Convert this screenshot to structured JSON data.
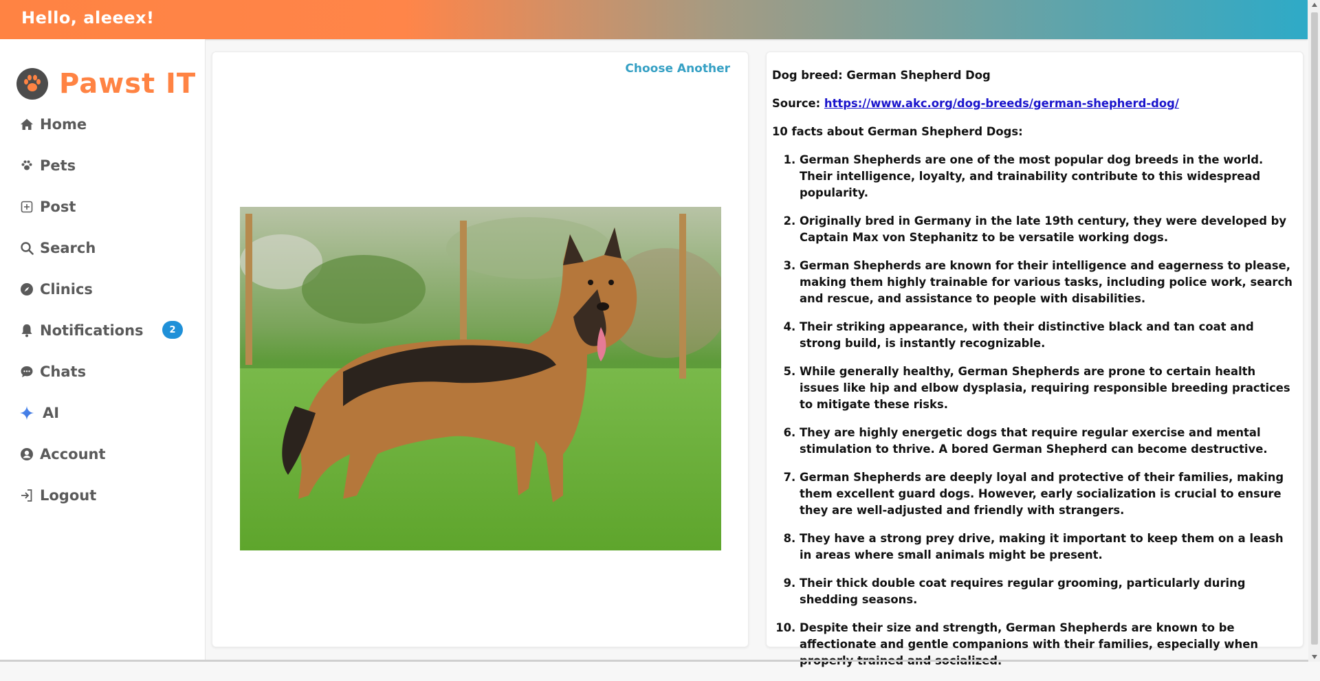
{
  "header": {
    "greeting": "Hello, aleeex!"
  },
  "brand": {
    "name": "Pawst IT",
    "logo_icon": "paw-icon",
    "accent": "#ff8343"
  },
  "sidebar": {
    "items": [
      {
        "label": "Home",
        "icon": "home-icon"
      },
      {
        "label": "Pets",
        "icon": "paw-icon"
      },
      {
        "label": "Post",
        "icon": "plus-square-icon"
      },
      {
        "label": "Search",
        "icon": "search-icon"
      },
      {
        "label": "Clinics",
        "icon": "compass-icon"
      },
      {
        "label": "Notifications",
        "icon": "bell-icon",
        "badge": "2"
      },
      {
        "label": "Chats",
        "icon": "chat-icon"
      },
      {
        "label": "AI",
        "icon": "sparkle-icon"
      },
      {
        "label": "Account",
        "icon": "user-circle-icon"
      },
      {
        "label": "Logout",
        "icon": "logout-icon"
      }
    ]
  },
  "image_panel": {
    "choose_label": "Choose Another",
    "photo": "german-shepherd-photo"
  },
  "info": {
    "breed_prefix": "Dog breed: ",
    "breed": "German Shepherd Dog",
    "source_prefix": "Source: ",
    "source_url": "https://www.akc.org/dog-breeds/german-shepherd-dog/",
    "facts_heading": "10 facts about German Shepherd Dogs:",
    "facts": [
      "German Shepherds are one of the most popular dog breeds in the world. Their intelligence, loyalty, and trainability contribute to this widespread popularity.",
      "Originally bred in Germany in the late 19th century, they were developed by Captain Max von Stephanitz to be versatile working dogs.",
      "German Shepherds are known for their intelligence and eagerness to please, making them highly trainable for various tasks, including police work, search and rescue, and assistance to people with disabilities.",
      "Their striking appearance, with their distinctive black and tan coat and strong build, is instantly recognizable.",
      "While generally healthy, German Shepherds are prone to certain health issues like hip and elbow dysplasia, requiring responsible breeding practices to mitigate these risks.",
      "They are highly energetic dogs that require regular exercise and mental stimulation to thrive. A bored German Shepherd can become destructive.",
      "German Shepherds are deeply loyal and protective of their families, making them excellent guard dogs. However, early socialization is crucial to ensure they are well-adjusted and friendly with strangers.",
      "They have a strong prey drive, making it important to keep them on a leash in areas where small animals might be present.",
      "Their thick double coat requires regular grooming, particularly during shedding seasons.",
      "Despite their size and strength, German Shepherds are known to be affectionate and gentle companions with their families, especially when properly trained and socialized."
    ]
  },
  "colors": {
    "header_start": "#ff8343",
    "header_end": "#2eaac7",
    "link": "#1a14cc",
    "badge": "#1f90d8"
  }
}
